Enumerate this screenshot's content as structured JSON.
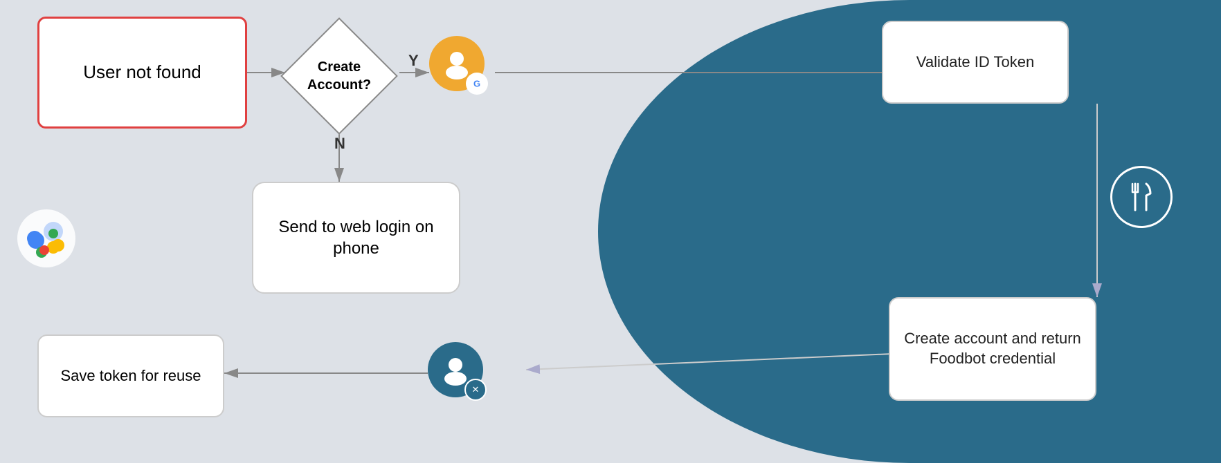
{
  "nodes": {
    "user_not_found": "User not found",
    "create_account_question": "Create\nAccount?",
    "send_to_web": "Send to web login\non phone",
    "save_token": "Save token\nfor reuse",
    "validate_id": "Validate ID\nToken",
    "create_account": "Create account and\nreturn Foodbot\ncredential"
  },
  "labels": {
    "y": "Y",
    "n": "N"
  },
  "icons": {
    "assistant": "google-assistant-icon",
    "user_google": "user-google-icon",
    "user_foodbot": "user-foodbot-icon",
    "foodbot_right": "foodbot-circle-icon"
  },
  "colors": {
    "background_left": "#dde1e7",
    "background_right": "#2a6b8a",
    "node_border_red": "#e04040",
    "node_border_normal": "#cccccc",
    "arrow_color": "#888888",
    "text_dark": "#222222",
    "white": "#ffffff"
  }
}
